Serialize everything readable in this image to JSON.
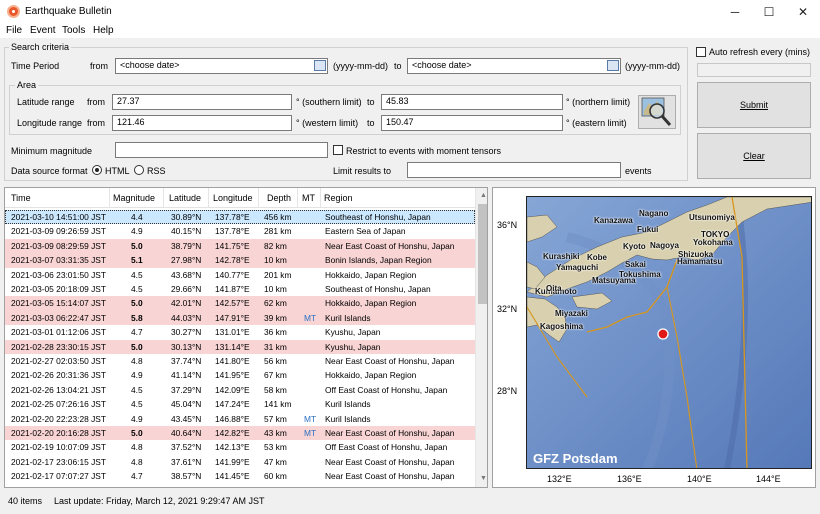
{
  "window": {
    "title": "Earthquake Bulletin",
    "minimize": "─",
    "maximize": "☐",
    "close": "✕"
  },
  "menu": [
    "File",
    "Event",
    "Tools",
    "Help"
  ],
  "search": {
    "group_label": "Search criteria",
    "period_label": "Time Period",
    "from_label": "from",
    "from_value": "<choose date>",
    "date_hint": "(yyyy-mm-dd)",
    "to_label": "to",
    "to_value": "<choose date>",
    "area_label": "Area",
    "lat_label": "Latitude range",
    "lat_from_label": "from",
    "lat_from": "27.37",
    "lat_from_hint": "° (southern limit)",
    "lat_to_label": "to",
    "lat_to": "45.83",
    "lat_to_hint": "° (northern limit)",
    "lon_label": "Longitude range",
    "lon_from_label": "from",
    "lon_from": "121.46",
    "lon_from_hint": "° (western limit)",
    "lon_to_label": "to",
    "lon_to": "150.47",
    "lon_to_hint": "° (eastern limit)",
    "min_mag_label": "Minimum magnitude",
    "min_mag_value": "",
    "tensor_label": "Restrict to events with moment tensors",
    "format_label": "Data source format",
    "format_html": "HTML",
    "format_rss": "RSS",
    "limit_label": "Limit results to",
    "limit_value": "",
    "limit_unit": "events"
  },
  "controls": {
    "auto_refresh_label": "Auto refresh every (mins)",
    "auto_refresh_value": "",
    "submit": "Submit",
    "clear": "Clear"
  },
  "table": {
    "headers": [
      "Time",
      "Magnitude",
      "Latitude",
      "Longitude",
      "Depth",
      "MT",
      "Region"
    ],
    "rows": [
      [
        "2021-03-10 14:51:00 JST",
        "4.4",
        "30.89°N",
        "137.78°E",
        "456 km",
        "",
        "Southeast of Honshu, Japan"
      ],
      [
        "2021-03-09 09:26:59 JST",
        "4.9",
        "40.15°N",
        "137.78°E",
        "281 km",
        "",
        "Eastern Sea of Japan"
      ],
      [
        "2021-03-09 08:29:59 JST",
        "5.0",
        "38.79°N",
        "141.75°E",
        "82 km",
        "",
        "Near East Coast of Honshu, Japan"
      ],
      [
        "2021-03-07 03:31:35 JST",
        "5.1",
        "27.98°N",
        "142.78°E",
        "10 km",
        "",
        "Bonin Islands, Japan Region"
      ],
      [
        "2021-03-06 23:01:50 JST",
        "4.5",
        "43.68°N",
        "140.77°E",
        "201 km",
        "",
        "Hokkaido, Japan Region"
      ],
      [
        "2021-03-05 20:18:09 JST",
        "4.5",
        "29.66°N",
        "141.87°E",
        "10 km",
        "",
        "Southeast of Honshu, Japan"
      ],
      [
        "2021-03-05 15:14:07 JST",
        "5.0",
        "42.01°N",
        "142.57°E",
        "62 km",
        "",
        "Hokkaido, Japan Region"
      ],
      [
        "2021-03-03 06:22:47 JST",
        "5.8",
        "44.03°N",
        "147.91°E",
        "39 km",
        "MT",
        "Kuril Islands"
      ],
      [
        "2021-03-01 01:12:06 JST",
        "4.7",
        "30.27°N",
        "131.01°E",
        "36 km",
        "",
        "Kyushu, Japan"
      ],
      [
        "2021-02-28 23:30:15 JST",
        "5.0",
        "30.13°N",
        "131.14°E",
        "31 km",
        "",
        "Kyushu, Japan"
      ],
      [
        "2021-02-27 02:03:50 JST",
        "4.8",
        "37.74°N",
        "141.80°E",
        "56 km",
        "",
        "Near East Coast of Honshu, Japan"
      ],
      [
        "2021-02-26 20:31:36 JST",
        "4.9",
        "41.14°N",
        "141.95°E",
        "67 km",
        "",
        "Hokkaido, Japan Region"
      ],
      [
        "2021-02-26 13:04:21 JST",
        "4.5",
        "37.29°N",
        "142.09°E",
        "58 km",
        "",
        "Off East Coast of Honshu, Japan"
      ],
      [
        "2021-02-25 07:26:16 JST",
        "4.5",
        "45.04°N",
        "147.24°E",
        "141 km",
        "",
        "Kuril Islands"
      ],
      [
        "2021-02-20 22:23:28 JST",
        "4.9",
        "43.45°N",
        "146.88°E",
        "57 km",
        "MT",
        "Kuril Islands"
      ],
      [
        "2021-02-20 20:16:28 JST",
        "5.0",
        "40.64°N",
        "142.82°E",
        "43 km",
        "MT",
        "Near East Coast of Honshu, Japan"
      ],
      [
        "2021-02-19 10:07:09 JST",
        "4.8",
        "37.52°N",
        "142.13°E",
        "53 km",
        "",
        "Off East Coast of Honshu, Japan"
      ],
      [
        "2021-02-17 23:06:15 JST",
        "4.8",
        "37.61°N",
        "141.99°E",
        "47 km",
        "",
        "Near East Coast of Honshu, Japan"
      ],
      [
        "2021-02-17 07:07:27 JST",
        "4.7",
        "38.57°N",
        "141.45°E",
        "60 km",
        "",
        "Near East Coast of Honshu, Japan"
      ],
      [
        "2021-02-17 05:59:57 JST",
        "4.8",
        "30.09°N",
        "131.09°E",
        "32 km",
        "",
        "Kyushu, Japan"
      ]
    ],
    "highlighted_rows": [
      2,
      3,
      6,
      7,
      9,
      15
    ],
    "selected_row": 0
  },
  "map": {
    "lat_labels": [
      "36°N",
      "32°N",
      "28°N"
    ],
    "lon_labels": [
      "132°E",
      "136°E",
      "140°E",
      "144°E"
    ],
    "credit": "GFZ Potsdam",
    "cities": [
      "Nagano",
      "Utsunomiya",
      "Kanazawa",
      "Fukui",
      "TOKYO",
      "Yokohama",
      "Kyoto",
      "Nagoya",
      "Shizuoka",
      "Kurashiki",
      "Kobe",
      "Hamamatsu",
      "Yamaguchi",
      "Sakai",
      "Tokushima",
      "Matsuyama",
      "Kumamoto",
      "Oita",
      "Miyazaki",
      "Kagoshima"
    ]
  },
  "status": {
    "items": "40 items",
    "last_update": "Last update: Friday, March 12, 2021 9:29:47 AM JST"
  }
}
